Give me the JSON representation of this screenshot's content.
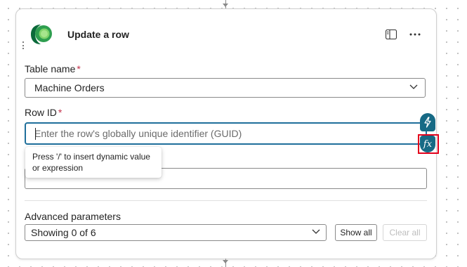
{
  "action": {
    "title": "Update a row"
  },
  "fields": {
    "table_name": {
      "label": "Table name",
      "required_mark": "*",
      "value": "Machine Orders"
    },
    "row_id": {
      "label": "Row ID",
      "required_mark": "*",
      "placeholder": "Enter the row's globally unique identifier (GUID)"
    }
  },
  "tooltip": {
    "line1": "Press '/' to insert dynamic value",
    "line2": "or expression"
  },
  "advanced": {
    "label": "Advanced parameters",
    "selected": "Showing 0 of 6",
    "show_all_label": "Show all",
    "clear_all_label": "Clear all"
  },
  "dynamic_buttons": {
    "fx_label": "fx"
  },
  "colors": {
    "accent": "#176a85",
    "focus_border": "#1f6f9b",
    "required": "#c4314b",
    "highlight": "#e3001b"
  },
  "icons": [
    "dataverse-logo-icon",
    "panel-icon",
    "more-options-icon",
    "chevron-down-icon",
    "lightning-icon",
    "fx-icon"
  ]
}
